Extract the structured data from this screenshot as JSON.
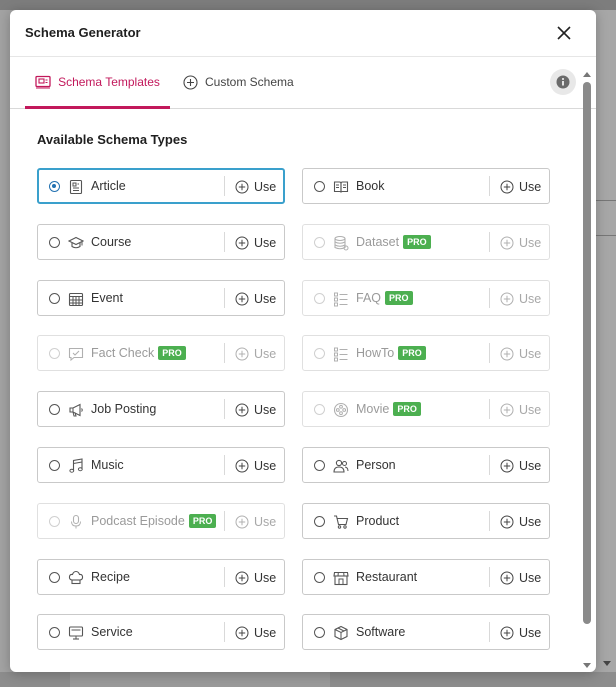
{
  "modal": {
    "title": "Schema Generator"
  },
  "tabs": [
    {
      "label": "Schema Templates",
      "active": true
    },
    {
      "label": "Custom Schema",
      "active": false
    }
  ],
  "section_title": "Available Schema Types",
  "use_label": "Use",
  "pro_label": "PRO",
  "colors": {
    "accent": "#c2185b",
    "selected_border": "#3aa0cc",
    "radio_selected": "#2271b1",
    "pro_badge": "#4caf50"
  },
  "schema_types": [
    {
      "label": "Article",
      "icon": "article-icon",
      "pro": false,
      "selected": true
    },
    {
      "label": "Book",
      "icon": "book-icon",
      "pro": false,
      "selected": false
    },
    {
      "label": "Course",
      "icon": "graduation-cap-icon",
      "pro": false,
      "selected": false
    },
    {
      "label": "Dataset",
      "icon": "database-icon",
      "pro": true,
      "selected": false
    },
    {
      "label": "Event",
      "icon": "calendar-icon",
      "pro": false,
      "selected": false
    },
    {
      "label": "FAQ",
      "icon": "list-icon",
      "pro": true,
      "selected": false
    },
    {
      "label": "Fact Check",
      "icon": "chat-check-icon",
      "pro": true,
      "selected": false
    },
    {
      "label": "HowTo",
      "icon": "list-icon",
      "pro": true,
      "selected": false
    },
    {
      "label": "Job Posting",
      "icon": "megaphone-icon",
      "pro": false,
      "selected": false
    },
    {
      "label": "Movie",
      "icon": "film-reel-icon",
      "pro": true,
      "selected": false
    },
    {
      "label": "Music",
      "icon": "music-note-icon",
      "pro": false,
      "selected": false
    },
    {
      "label": "Person",
      "icon": "people-icon",
      "pro": false,
      "selected": false
    },
    {
      "label": "Podcast Episode",
      "icon": "microphone-icon",
      "pro": true,
      "selected": false
    },
    {
      "label": "Product",
      "icon": "cart-icon",
      "pro": false,
      "selected": false
    },
    {
      "label": "Recipe",
      "icon": "chef-hat-icon",
      "pro": false,
      "selected": false
    },
    {
      "label": "Restaurant",
      "icon": "storefront-icon",
      "pro": false,
      "selected": false
    },
    {
      "label": "Service",
      "icon": "monitor-icon",
      "pro": false,
      "selected": false
    },
    {
      "label": "Software",
      "icon": "box-icon",
      "pro": false,
      "selected": false
    }
  ]
}
